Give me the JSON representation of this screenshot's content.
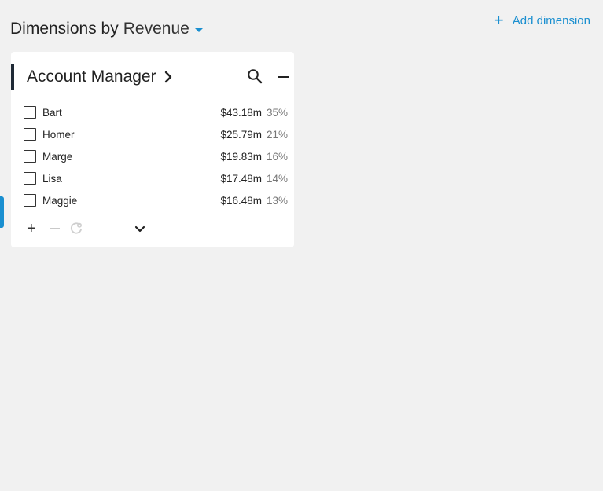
{
  "header": {
    "title_prefix": "Dimensions by",
    "metric": "Revenue"
  },
  "add_dimension": {
    "icon": "plus-icon",
    "label": "Add dimension"
  },
  "card": {
    "title": "Account Manager",
    "rows": [
      {
        "name": "Bart",
        "value": "$43.18m",
        "pct": "35%",
        "checked": false
      },
      {
        "name": "Homer",
        "value": "$25.79m",
        "pct": "21%",
        "checked": false
      },
      {
        "name": "Marge",
        "value": "$19.83m",
        "pct": "16%",
        "checked": false
      },
      {
        "name": "Lisa",
        "value": "$17.48m",
        "pct": "14%",
        "checked": false
      },
      {
        "name": "Maggie",
        "value": "$16.48m",
        "pct": "13%",
        "checked": false
      }
    ],
    "icons": {
      "title_chevron": "chevron-right-icon",
      "search": "search-icon",
      "collapse": "minus-icon",
      "include": "plus-icon",
      "exclude": "minus-icon",
      "clear": "reset-icon",
      "expand": "chevron-down-icon"
    }
  },
  "colors": {
    "accent": "#1a8fd0",
    "background": "#f1f1f1",
    "card": "#ffffff",
    "title_bar": "#1f2a36",
    "percent_text": "#777777"
  }
}
